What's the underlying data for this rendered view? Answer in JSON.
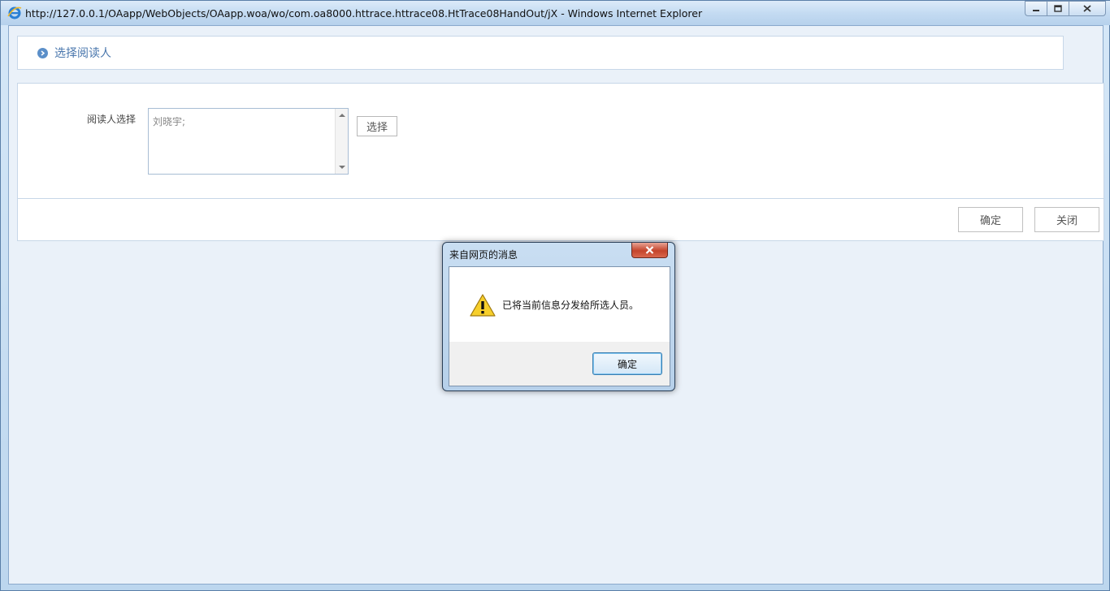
{
  "window": {
    "title": "http://127.0.0.1/OAapp/WebObjects/OAapp.woa/wo/com.oa8000.httrace.httrace08.HtTrace08HandOut/jX - Windows Internet Explorer",
    "icons": {
      "browser": "ie-logo-icon",
      "minimize": "minimize-icon",
      "maximize": "maximize-icon",
      "close": "close-icon"
    }
  },
  "page": {
    "section_title": "选择阅读人",
    "form": {
      "label": "阅读人选择",
      "reader_value": "刘晓宇;",
      "choose_button": "选择"
    },
    "footer": {
      "ok_button": "确定",
      "close_button": "关闭"
    }
  },
  "dialog": {
    "title": "来自网页的消息",
    "message": "已将当前信息分发给所选人员。",
    "ok_button": "确定",
    "icon": "warning-icon"
  },
  "colors": {
    "accent": "#4a77ad",
    "page_bg": "#eaf1f9",
    "dialog_close": "#c4442b"
  }
}
